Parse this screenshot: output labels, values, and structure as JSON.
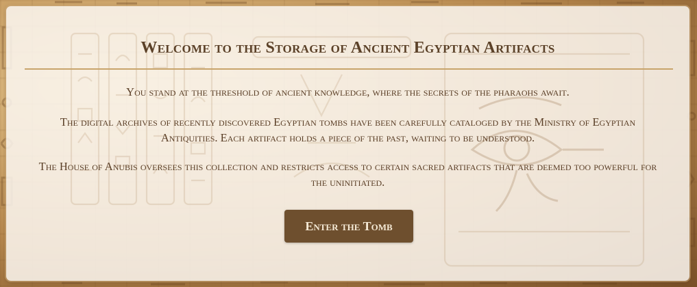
{
  "welcome": {
    "title": "Welcome to the Storage of Ancient Egyptian Artifacts",
    "paragraphs": [
      "You stand at the threshold of ancient knowledge, where the secrets of the pharaohs await.",
      "The digital archives of recently discovered Egyptian tombs have been carefully cataloged by the Ministry of Egyptian Antiquities. Each artifact holds a piece of the past, waiting to be understood.",
      "The House of Anubis oversees this collection and restricts access to certain sacred artifacts that are deemed too powerful for the uninitiated."
    ],
    "enter_button": "Enter the Tomb"
  },
  "icons": [
    "hieroglyph-wall",
    "eye-of-horus-icon"
  ]
}
